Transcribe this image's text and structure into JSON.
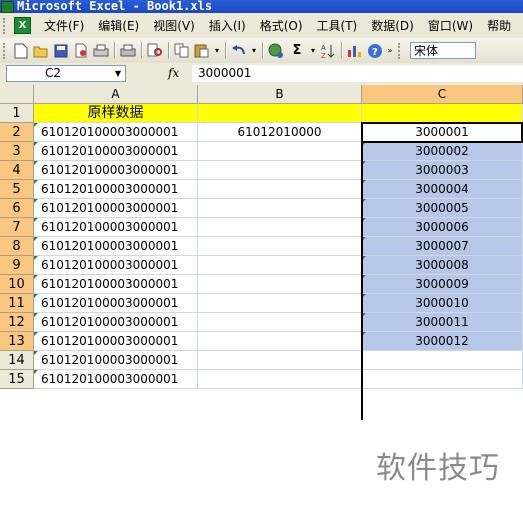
{
  "window": {
    "title": "Microsoft Excel - Book1.xls"
  },
  "menu": [
    "文件(F)",
    "编辑(E)",
    "视图(V)",
    "插入(I)",
    "格式(O)",
    "工具(T)",
    "数据(D)",
    "窗口(W)",
    "帮助"
  ],
  "toolbar": {
    "buttons": [
      "new-icon",
      "open-icon",
      "save-icon",
      "permission-icon",
      "print-icon",
      "print-preview-icon",
      "research-icon",
      "copy-icon",
      "paste-icon",
      "undo-icon",
      "hyperlink-icon",
      "autosum-icon",
      "sort-ascending-icon",
      "chart-wizard-icon",
      "help-icon"
    ],
    "sigma": "Σ",
    "font": "宋体"
  },
  "formula_bar": {
    "name_box": "C2",
    "fx": "fx",
    "value": "3000001"
  },
  "columns": [
    "A",
    "B",
    "C"
  ],
  "rows": [
    {
      "num": "1",
      "a": "原样数据",
      "b": "",
      "c": ""
    },
    {
      "num": "2",
      "a": "610120100003000001",
      "b": "61012010000",
      "c": "3000001"
    },
    {
      "num": "3",
      "a": "610120100003000001",
      "b": "",
      "c": "3000002"
    },
    {
      "num": "4",
      "a": "610120100003000001",
      "b": "",
      "c": "3000003"
    },
    {
      "num": "5",
      "a": "610120100003000001",
      "b": "",
      "c": "3000004"
    },
    {
      "num": "6",
      "a": "610120100003000001",
      "b": "",
      "c": "3000005"
    },
    {
      "num": "7",
      "a": "610120100003000001",
      "b": "",
      "c": "3000006"
    },
    {
      "num": "8",
      "a": "610120100003000001",
      "b": "",
      "c": "3000007"
    },
    {
      "num": "9",
      "a": "610120100003000001",
      "b": "",
      "c": "3000008"
    },
    {
      "num": "10",
      "a": "610120100003000001",
      "b": "",
      "c": "3000009"
    },
    {
      "num": "11",
      "a": "610120100003000001",
      "b": "",
      "c": "3000010"
    },
    {
      "num": "12",
      "a": "610120100003000001",
      "b": "",
      "c": "3000011"
    },
    {
      "num": "13",
      "a": "610120100003000001",
      "b": "",
      "c": "3000012"
    },
    {
      "num": "14",
      "a": "610120100003000001",
      "b": "",
      "c": ""
    },
    {
      "num": "15",
      "a": "610120100003000001",
      "b": "",
      "c": ""
    }
  ],
  "watermark": "软件技巧"
}
